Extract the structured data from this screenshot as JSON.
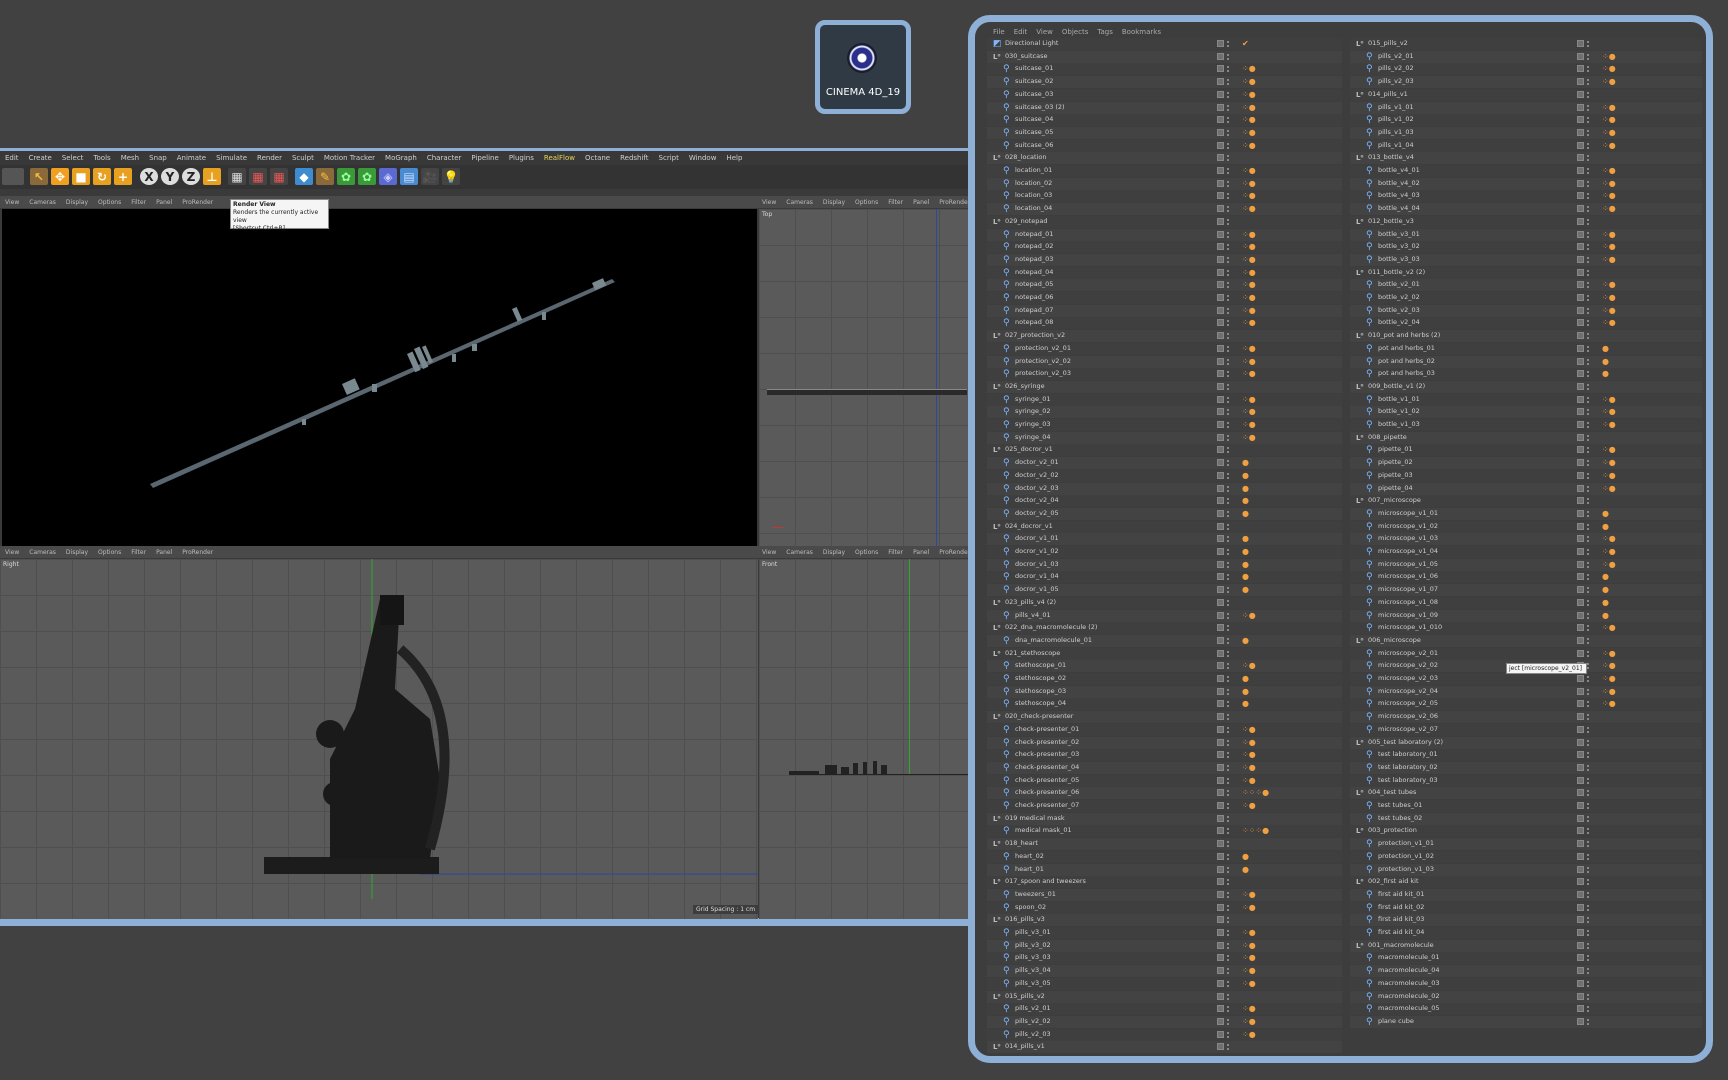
{
  "desktop_icon": {
    "label": "CINEMA 4D_19",
    "icon": "cinema4d-icon"
  },
  "menubar": [
    {
      "label": "Edit"
    },
    {
      "label": "Create"
    },
    {
      "label": "Select"
    },
    {
      "label": "Tools"
    },
    {
      "label": "Mesh"
    },
    {
      "label": "Snap"
    },
    {
      "label": "Animate"
    },
    {
      "label": "Simulate"
    },
    {
      "label": "Render"
    },
    {
      "label": "Sculpt"
    },
    {
      "label": "Motion Tracker"
    },
    {
      "label": "MoGraph"
    },
    {
      "label": "Character"
    },
    {
      "label": "Pipeline"
    },
    {
      "label": "Plugins"
    },
    {
      "label": "RealFlow",
      "active": true
    },
    {
      "label": "Octane"
    },
    {
      "label": "Redshift"
    },
    {
      "label": "Script"
    },
    {
      "label": "Window"
    },
    {
      "label": "Help"
    }
  ],
  "viewport_menu": [
    "View",
    "Cameras",
    "Display",
    "Options",
    "Filter",
    "Panel",
    "ProRender"
  ],
  "viewports": {
    "top": "Top",
    "right": "Right",
    "front": "Front"
  },
  "tooltip": {
    "title": "Render View",
    "line1": "Renders the currently active view",
    "line2": "[Shortcut Ctrl+R]"
  },
  "grid_spacing": "Grid Spacing : 1 cm",
  "object_manager": {
    "menu": [
      "File",
      "Edit",
      "View",
      "Objects",
      "Tags",
      "Bookmarks"
    ],
    "tooltip": "ject [microscope_v2_01]",
    "left_column": [
      {
        "name": "Directional Light",
        "type": "light",
        "tags": "✔"
      },
      {
        "name": "030_suitcase",
        "type": "null"
      },
      {
        "name": "suitcase_01",
        "type": "obj",
        "tags": "⁘●"
      },
      {
        "name": "suitcase_02",
        "type": "obj",
        "tags": "⁘●"
      },
      {
        "name": "suitcase_03",
        "type": "obj",
        "tags": "⁘●"
      },
      {
        "name": "suitcase_03 (2)",
        "type": "obj",
        "tags": "⁘●"
      },
      {
        "name": "suitcase_04",
        "type": "obj",
        "tags": "⁘●"
      },
      {
        "name": "suitcase_05",
        "type": "obj",
        "tags": "⁘●"
      },
      {
        "name": "suitcase_06",
        "type": "obj",
        "tags": "⁘●"
      },
      {
        "name": "028_location",
        "type": "null"
      },
      {
        "name": "location_01",
        "type": "obj",
        "tags": "⁘●"
      },
      {
        "name": "location_02",
        "type": "obj",
        "tags": "⁘●"
      },
      {
        "name": "location_03",
        "type": "obj",
        "tags": "⁘●"
      },
      {
        "name": "location_04",
        "type": "obj",
        "tags": "⁘●"
      },
      {
        "name": "029_notepad",
        "type": "null"
      },
      {
        "name": "notepad_01",
        "type": "obj",
        "tags": "⁘●"
      },
      {
        "name": "notepad_02",
        "type": "obj",
        "tags": "⁘●"
      },
      {
        "name": "notepad_03",
        "type": "obj",
        "tags": "⁘●"
      },
      {
        "name": "notepad_04",
        "type": "obj",
        "tags": "⁘●"
      },
      {
        "name": "notepad_05",
        "type": "obj",
        "tags": "⁘●"
      },
      {
        "name": "notepad_06",
        "type": "obj",
        "tags": "⁘●"
      },
      {
        "name": "notepad_07",
        "type": "obj",
        "tags": "⁘●"
      },
      {
        "name": "notepad_08",
        "type": "obj",
        "tags": "⁘●"
      },
      {
        "name": "027_protection_v2",
        "type": "null"
      },
      {
        "name": "protection_v2_01",
        "type": "obj",
        "tags": "⁘●"
      },
      {
        "name": "protection_v2_02",
        "type": "obj",
        "tags": "⁘●"
      },
      {
        "name": "protection_v2_03",
        "type": "obj",
        "tags": "⁘●"
      },
      {
        "name": "026_syringe",
        "type": "null"
      },
      {
        "name": "syringe_01",
        "type": "obj",
        "tags": "⁘●"
      },
      {
        "name": "syringe_02",
        "type": "obj",
        "tags": "⁘●"
      },
      {
        "name": "syringe_03",
        "type": "obj",
        "tags": "⁘●"
      },
      {
        "name": "syringe_04",
        "type": "obj",
        "tags": "⁘●"
      },
      {
        "name": "025_docror_v1",
        "type": "null"
      },
      {
        "name": "doctor_v2_01",
        "type": "obj",
        "tags": "●"
      },
      {
        "name": "doctor_v2_02",
        "type": "obj",
        "tags": "●"
      },
      {
        "name": "doctor_v2_03",
        "type": "obj",
        "tags": "●"
      },
      {
        "name": "doctor_v2_04",
        "type": "obj",
        "tags": "●"
      },
      {
        "name": "doctor_v2_05",
        "type": "obj",
        "tags": "●"
      },
      {
        "name": "024_docror_v1",
        "type": "null"
      },
      {
        "name": "docror_v1_01",
        "type": "obj",
        "tags": "●"
      },
      {
        "name": "docror_v1_02",
        "type": "obj",
        "tags": "●"
      },
      {
        "name": "docror_v1_03",
        "type": "obj",
        "tags": "●"
      },
      {
        "name": "docror_v1_04",
        "type": "obj",
        "tags": "●"
      },
      {
        "name": "docror_v1_05",
        "type": "obj",
        "tags": "●"
      },
      {
        "name": "023_pills_v4 (2)",
        "type": "null"
      },
      {
        "name": "pills_v4_01",
        "type": "obj",
        "tags": "⁘●"
      },
      {
        "name": "022_dna_macromolecule (2)",
        "type": "null"
      },
      {
        "name": "dna_macromolecule_01",
        "type": "obj",
        "tags": "●"
      },
      {
        "name": "021_stethoscope",
        "type": "null"
      },
      {
        "name": "stethoscope_01",
        "type": "obj",
        "tags": "⁘●"
      },
      {
        "name": "stethoscope_02",
        "type": "obj",
        "tags": "●"
      },
      {
        "name": "stethoscope_03",
        "type": "obj",
        "tags": "●"
      },
      {
        "name": "stethoscope_04",
        "type": "obj",
        "tags": "●"
      },
      {
        "name": "020_check-presenter",
        "type": "null"
      },
      {
        "name": "check-presenter_01",
        "type": "obj",
        "tags": "⁘●"
      },
      {
        "name": "check-presenter_02",
        "type": "obj",
        "tags": "⁘●"
      },
      {
        "name": "check-presenter_03",
        "type": "obj",
        "tags": "⁘●"
      },
      {
        "name": "check-presenter_04",
        "type": "obj",
        "tags": "⁘●"
      },
      {
        "name": "check-presenter_05",
        "type": "obj",
        "tags": "⁘●"
      },
      {
        "name": "check-presenter_06",
        "type": "obj",
        "tags": "⁘⁘⁘●"
      },
      {
        "name": "check-presenter_07",
        "type": "obj",
        "tags": "⁘●"
      },
      {
        "name": "019 medical mask",
        "type": "null"
      },
      {
        "name": "medical mask_01",
        "type": "obj",
        "tags": "⁘⁘⁘●"
      },
      {
        "name": "018_heart",
        "type": "null"
      },
      {
        "name": "heart_02",
        "type": "obj",
        "tags": "●"
      },
      {
        "name": "heart_01",
        "type": "obj",
        "tags": "●"
      },
      {
        "name": "017_spoon and tweezers",
        "type": "null"
      },
      {
        "name": "tweezers_01",
        "type": "obj",
        "tags": "⁘●"
      },
      {
        "name": "spoon_02",
        "type": "obj",
        "tags": "⁘●"
      },
      {
        "name": "016_pills_v3",
        "type": "null"
      },
      {
        "name": "pills_v3_01",
        "type": "obj",
        "tags": "⁘●"
      },
      {
        "name": "pills_v3_02",
        "type": "obj",
        "tags": "⁘●"
      },
      {
        "name": "pills_v3_03",
        "type": "obj",
        "tags": "⁘●"
      },
      {
        "name": "pills_v3_04",
        "type": "obj",
        "tags": "⁘●"
      },
      {
        "name": "pills_v3_05",
        "type": "obj",
        "tags": "⁘●"
      },
      {
        "name": "015_pills_v2",
        "type": "null"
      },
      {
        "name": "pills_v2_01",
        "type": "obj",
        "tags": "⁘●"
      },
      {
        "name": "pills_v2_02",
        "type": "obj",
        "tags": "⁘●"
      },
      {
        "name": "pills_v2_03",
        "type": "obj",
        "tags": "⁘●"
      },
      {
        "name": "014_pills_v1",
        "type": "null"
      }
    ],
    "right_column": [
      {
        "name": "015_pills_v2",
        "type": "null"
      },
      {
        "name": "pills_v2_01",
        "type": "obj",
        "tags": "⁘●"
      },
      {
        "name": "pills_v2_02",
        "type": "obj",
        "tags": "⁘●"
      },
      {
        "name": "pills_v2_03",
        "type": "obj",
        "tags": "⁘●"
      },
      {
        "name": "014_pills_v1",
        "type": "null"
      },
      {
        "name": "pills_v1_01",
        "type": "obj",
        "tags": "⁘●"
      },
      {
        "name": "pills_v1_02",
        "type": "obj",
        "tags": "⁘●"
      },
      {
        "name": "pills_v1_03",
        "type": "obj",
        "tags": "⁘●"
      },
      {
        "name": "pills_v1_04",
        "type": "obj",
        "tags": "⁘●"
      },
      {
        "name": "013_bottle_v4",
        "type": "null"
      },
      {
        "name": "bottle_v4_01",
        "type": "obj",
        "tags": "⁘●"
      },
      {
        "name": "bottle_v4_02",
        "type": "obj",
        "tags": "⁘●"
      },
      {
        "name": "bottle_v4_03",
        "type": "obj",
        "tags": "⁘●"
      },
      {
        "name": "bottle_v4_04",
        "type": "obj",
        "tags": "⁘●"
      },
      {
        "name": "012_bottle_v3",
        "type": "null"
      },
      {
        "name": "bottle_v3_01",
        "type": "obj",
        "tags": "⁘●"
      },
      {
        "name": "bottle_v3_02",
        "type": "obj",
        "tags": "⁘●"
      },
      {
        "name": "bottle_v3_03",
        "type": "obj",
        "tags": "⁘●"
      },
      {
        "name": "011_bottle_v2 (2)",
        "type": "null"
      },
      {
        "name": "bottle_v2_01",
        "type": "obj",
        "tags": "⁘●"
      },
      {
        "name": "bottle_v2_02",
        "type": "obj",
        "tags": "⁘●"
      },
      {
        "name": "bottle_v2_03",
        "type": "obj",
        "tags": "⁘●"
      },
      {
        "name": "bottle_v2_04",
        "type": "obj",
        "tags": "⁘●"
      },
      {
        "name": "010_pot and herbs (2)",
        "type": "null"
      },
      {
        "name": "pot and herbs_01",
        "type": "obj",
        "tags": "●"
      },
      {
        "name": "pot and herbs_02",
        "type": "obj",
        "tags": "●"
      },
      {
        "name": "pot and herbs_03",
        "type": "obj",
        "tags": "●"
      },
      {
        "name": "009_bottle_v1 (2)",
        "type": "null"
      },
      {
        "name": "bottle_v1_01",
        "type": "obj",
        "tags": "⁘●"
      },
      {
        "name": "bottle_v1_02",
        "type": "obj",
        "tags": "⁘●"
      },
      {
        "name": "bottle_v1_03",
        "type": "obj",
        "tags": "⁘●"
      },
      {
        "name": "008_pipette",
        "type": "null"
      },
      {
        "name": "pipette_01",
        "type": "obj",
        "tags": "⁘●"
      },
      {
        "name": "pipette_02",
        "type": "obj",
        "tags": "⁘●"
      },
      {
        "name": "pipette_03",
        "type": "obj",
        "tags": "⁘●"
      },
      {
        "name": "pipette_04",
        "type": "obj",
        "tags": "⁘●"
      },
      {
        "name": "007_microscope",
        "type": "null"
      },
      {
        "name": "microscope_v1_01",
        "type": "obj",
        "tags": "●"
      },
      {
        "name": "microscope_v1_02",
        "type": "obj",
        "tags": "●"
      },
      {
        "name": "microscope_v1_03",
        "type": "obj",
        "tags": "⁘●"
      },
      {
        "name": "microscope_v1_04",
        "type": "obj",
        "tags": "⁘●"
      },
      {
        "name": "microscope_v1_05",
        "type": "obj",
        "tags": "⁘●"
      },
      {
        "name": "microscope_v1_06",
        "type": "obj",
        "tags": "●"
      },
      {
        "name": "microscope_v1_07",
        "type": "obj",
        "tags": "●"
      },
      {
        "name": "microscope_v1_08",
        "type": "obj",
        "tags": "●"
      },
      {
        "name": "microscope_v1_09",
        "type": "obj",
        "tags": "●"
      },
      {
        "name": "microscope_v1_010",
        "type": "obj",
        "tags": "⁘●"
      },
      {
        "name": "006_microscope",
        "type": "null"
      },
      {
        "name": "microscope_v2_01",
        "type": "obj",
        "tags": "⁘●"
      },
      {
        "name": "microscope_v2_02",
        "type": "obj",
        "tags": "⁘●"
      },
      {
        "name": "microscope_v2_03",
        "type": "obj",
        "tags": "⁘●"
      },
      {
        "name": "microscope_v2_04",
        "type": "obj",
        "tags": "⁘●"
      },
      {
        "name": "microscope_v2_05",
        "type": "obj",
        "tags": "⁘●"
      },
      {
        "name": "microscope_v2_06",
        "type": "obj"
      },
      {
        "name": "microscope_v2_07",
        "type": "obj"
      },
      {
        "name": "005_test laboratory (2)",
        "type": "null"
      },
      {
        "name": "test laboratory_01",
        "type": "obj"
      },
      {
        "name": "test laboratory_02",
        "type": "obj"
      },
      {
        "name": "test laboratory_03",
        "type": "obj"
      },
      {
        "name": "004_test tubes",
        "type": "null"
      },
      {
        "name": "test tubes_01",
        "type": "obj"
      },
      {
        "name": "test tubes_02",
        "type": "obj"
      },
      {
        "name": "003_protection",
        "type": "null"
      },
      {
        "name": "protection_v1_01",
        "type": "obj"
      },
      {
        "name": "protection_v1_02",
        "type": "obj"
      },
      {
        "name": "protection_v1_03",
        "type": "obj"
      },
      {
        "name": "002_first aid kit",
        "type": "null"
      },
      {
        "name": "first aid kit_01",
        "type": "obj"
      },
      {
        "name": "first aid kit_02",
        "type": "obj"
      },
      {
        "name": "first aid kit_03",
        "type": "obj"
      },
      {
        "name": "first aid kit_04",
        "type": "obj"
      },
      {
        "name": "001_macromolecule",
        "type": "null"
      },
      {
        "name": "macromolecule_01",
        "type": "obj"
      },
      {
        "name": "macromolecule_04",
        "type": "obj"
      },
      {
        "name": "macromolecule_03",
        "type": "obj"
      },
      {
        "name": "macromolecule_02",
        "type": "obj"
      },
      {
        "name": "macromolecule_05",
        "type": "obj"
      },
      {
        "name": "plane cube",
        "type": "obj"
      }
    ]
  },
  "colors": {
    "accent_frame": "#8fb0d6",
    "tag_orange": "#f0a040",
    "realflow_yellow": "#e7d35b"
  }
}
